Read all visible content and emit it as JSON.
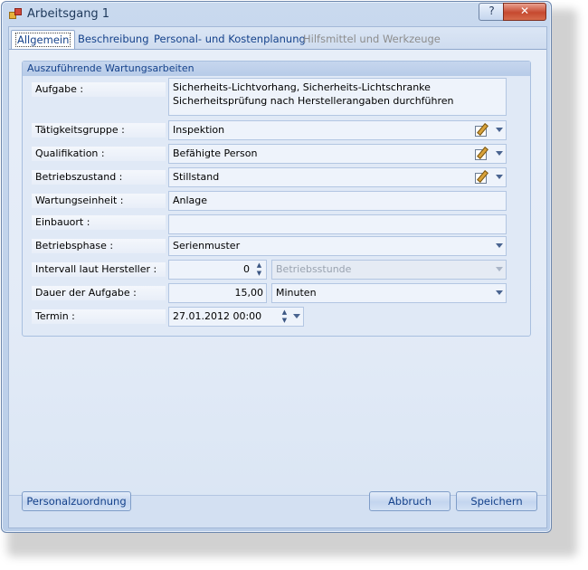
{
  "window": {
    "title": "Arbeitsgang 1",
    "help_label": "?",
    "close_label": "✕"
  },
  "tabs": [
    {
      "label": "Allgemein",
      "active": true
    },
    {
      "label": "Beschreibung",
      "active": false
    },
    {
      "label": "Personal- und Kostenplanung",
      "active": false
    },
    {
      "label": "Hilfsmittel und Werkzeuge",
      "active": false,
      "disabled": true
    }
  ],
  "group": {
    "title": "Auszuführende Wartungsarbeiten"
  },
  "fields": {
    "aufgabe": {
      "label": "Aufgabe :",
      "value": "Sicherheits-Lichtvorhang, Sicherheits-Lichtschranke Sicherheitsprüfung nach Herstellerangaben durchführen"
    },
    "taetigkeitsgruppe": {
      "label": "Tätigkeitsgruppe :",
      "value": "Inspektion"
    },
    "qualifikation": {
      "label": "Qualifikation :",
      "value": "Befähigte Person"
    },
    "betriebszustand": {
      "label": "Betriebszustand :",
      "value": "Stillstand"
    },
    "wartungseinheit": {
      "label": "Wartungseinheit :",
      "value": "Anlage"
    },
    "einbauort": {
      "label": "Einbauort :",
      "value": ""
    },
    "betriebsphase": {
      "label": "Betriebsphase :",
      "value": "Serienmuster"
    },
    "intervall": {
      "label": "Intervall laut Hersteller :",
      "value": "0",
      "unit": "Betriebsstunde"
    },
    "dauer": {
      "label": "Dauer der Aufgabe :",
      "value": "15,00",
      "unit": "Minuten"
    },
    "termin": {
      "label": "Termin :",
      "value": "27.01.2012 00:00"
    }
  },
  "buttons": {
    "personalzuordnung": "Personalzuordnung",
    "abbruch": "Abbruch",
    "speichern": "Speichern"
  },
  "icons": {
    "edit": "edit-icon",
    "dropdown": "chevron-down-icon",
    "spin": "spin-icon"
  }
}
